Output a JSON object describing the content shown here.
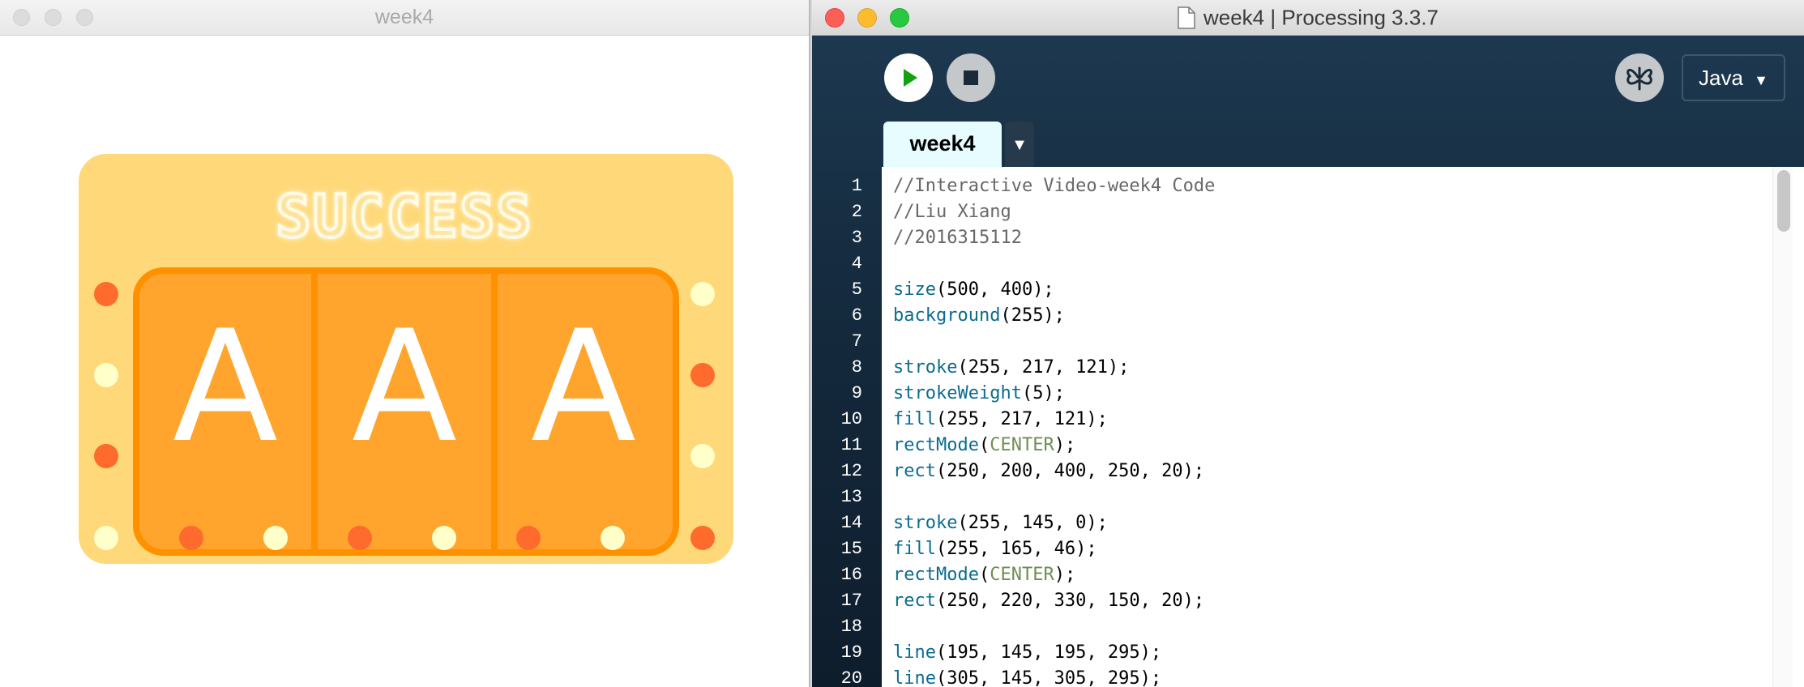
{
  "sketch_window": {
    "title": "week4",
    "overlay_text": "SUCCESS",
    "reels": [
      "A",
      "A",
      "A"
    ]
  },
  "ide": {
    "title": "week4 | Processing 3.3.7",
    "mode": "Java",
    "mode_caret": "▼",
    "tabs": [
      {
        "label": "week4"
      }
    ],
    "tab_menu_glyph": "▼",
    "code_lines": [
      {
        "n": "1",
        "tokens": [
          {
            "t": "//Interactive Video-week4 Code",
            "c": "comment"
          }
        ]
      },
      {
        "n": "2",
        "tokens": [
          {
            "t": "//Liu Xiang",
            "c": "comment"
          }
        ]
      },
      {
        "n": "3",
        "tokens": [
          {
            "t": "//2016315112",
            "c": "comment"
          }
        ]
      },
      {
        "n": "4",
        "tokens": []
      },
      {
        "n": "5",
        "tokens": [
          {
            "t": "size",
            "c": "fn"
          },
          {
            "t": "(500, 400);",
            "c": ""
          }
        ]
      },
      {
        "n": "6",
        "tokens": [
          {
            "t": "background",
            "c": "fn"
          },
          {
            "t": "(255);",
            "c": ""
          }
        ]
      },
      {
        "n": "7",
        "tokens": []
      },
      {
        "n": "8",
        "tokens": [
          {
            "t": "stroke",
            "c": "fn"
          },
          {
            "t": "(255, 217, 121);",
            "c": ""
          }
        ]
      },
      {
        "n": "9",
        "tokens": [
          {
            "t": "strokeWeight",
            "c": "fn"
          },
          {
            "t": "(5);",
            "c": ""
          }
        ]
      },
      {
        "n": "10",
        "tokens": [
          {
            "t": "fill",
            "c": "fn"
          },
          {
            "t": "(255, 217, 121);",
            "c": ""
          }
        ]
      },
      {
        "n": "11",
        "tokens": [
          {
            "t": "rectMode",
            "c": "fn"
          },
          {
            "t": "(",
            "c": ""
          },
          {
            "t": "CENTER",
            "c": "const"
          },
          {
            "t": ");",
            "c": ""
          }
        ]
      },
      {
        "n": "12",
        "tokens": [
          {
            "t": "rect",
            "c": "fn"
          },
          {
            "t": "(250, 200, 400, 250, 20);",
            "c": ""
          }
        ]
      },
      {
        "n": "13",
        "tokens": []
      },
      {
        "n": "14",
        "tokens": [
          {
            "t": "stroke",
            "c": "fn"
          },
          {
            "t": "(255, 145, 0);",
            "c": ""
          }
        ]
      },
      {
        "n": "15",
        "tokens": [
          {
            "t": "fill",
            "c": "fn"
          },
          {
            "t": "(255, 165, 46);",
            "c": ""
          }
        ]
      },
      {
        "n": "16",
        "tokens": [
          {
            "t": "rectMode",
            "c": "fn"
          },
          {
            "t": "(",
            "c": ""
          },
          {
            "t": "CENTER",
            "c": "const"
          },
          {
            "t": ");",
            "c": ""
          }
        ]
      },
      {
        "n": "17",
        "tokens": [
          {
            "t": "rect",
            "c": "fn"
          },
          {
            "t": "(250, 220, 330, 150, 20);",
            "c": ""
          }
        ]
      },
      {
        "n": "18",
        "tokens": []
      },
      {
        "n": "19",
        "tokens": [
          {
            "t": "line",
            "c": "fn"
          },
          {
            "t": "(195, 145, 195, 295);",
            "c": ""
          }
        ]
      },
      {
        "n": "20",
        "tokens": [
          {
            "t": "line",
            "c": "fn"
          },
          {
            "t": "(305, 145, 305, 295);",
            "c": ""
          }
        ]
      }
    ]
  },
  "icons": {
    "run": "play-icon",
    "stop": "stop-icon",
    "debug": "butterfly-icon",
    "document": "document-icon"
  },
  "colors": {
    "panel_fill": "#ffd979",
    "reel_fill": "#ffa52e",
    "reel_stroke": "#ff9100",
    "light_orange": "#ff6b2c",
    "light_cream": "#ffffc9",
    "run_green": "#12a10f",
    "traffic_red": "#fc5f57",
    "traffic_yellow": "#fdbc2e",
    "traffic_green": "#28c840"
  }
}
